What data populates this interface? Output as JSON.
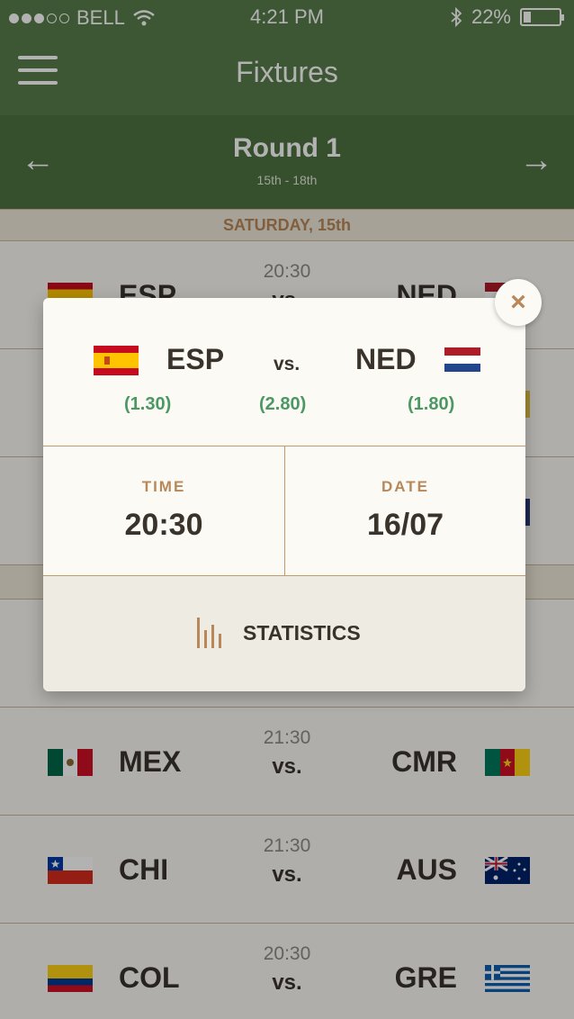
{
  "status_bar": {
    "carrier": "BELL",
    "time": "4:21 PM",
    "battery": "22%",
    "battery_fraction": 0.22
  },
  "nav": {
    "title": "Fixtures"
  },
  "round": {
    "title": "Round 1",
    "dates": "15th - 18th",
    "prev": "←",
    "next": "→"
  },
  "day_header": "SATURDAY, 15th",
  "matches": [
    {
      "home": "ESP",
      "away": "NED",
      "time": "20:30",
      "vs": "vs."
    },
    {
      "home": "MEX",
      "away": "CMR",
      "time": "21:30",
      "vs": "vs."
    },
    {
      "home": "CHI",
      "away": "AUS",
      "time": "21:30",
      "vs": "vs."
    },
    {
      "home": "COL",
      "away": "GRE",
      "time": "20:30",
      "vs": "vs."
    }
  ],
  "modal": {
    "home_team": "ESP",
    "away_team": "NED",
    "vs": "vs.",
    "home_odds": "(1.30)",
    "draw_odds": "(2.80)",
    "away_odds": "(1.80)",
    "time_label": "TIME",
    "time_value": "20:30",
    "date_label": "DATE",
    "date_value": "16/07",
    "stats_label": "STATISTICS",
    "close": "×"
  },
  "colors": {
    "green": "#587c4a",
    "dark_green": "#4e7140",
    "gold": "#b8875a",
    "odds_green": "#4c9863",
    "text": "#3a332c"
  }
}
